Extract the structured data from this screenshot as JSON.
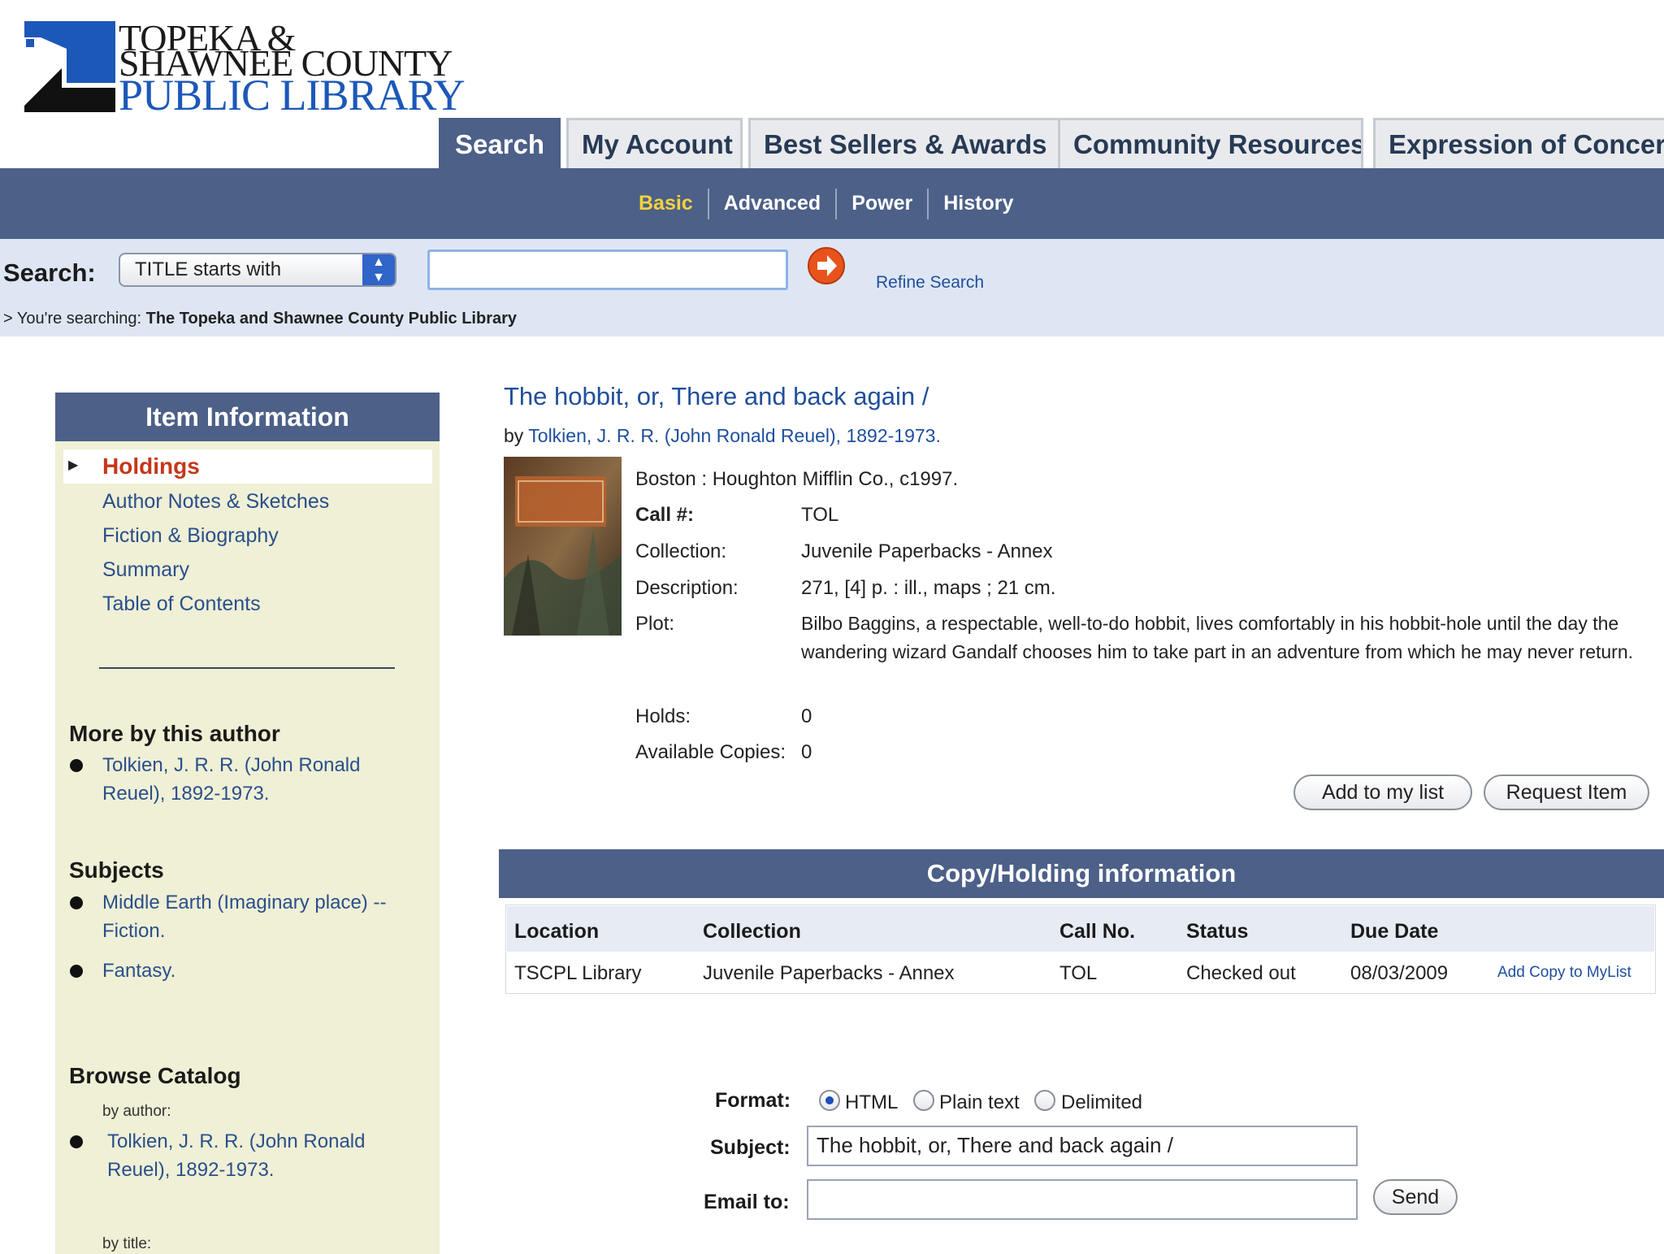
{
  "logo": {
    "line1": "TOPEKA &",
    "line2": "SHAWNEE COUNTY",
    "line3": "PUBLIC LIBRARY"
  },
  "tabs": [
    "Search",
    "My Account",
    "Best Sellers & Awards",
    "Community Resources",
    "Expression of Concern"
  ],
  "subnav": [
    "Basic",
    "Advanced",
    "Power",
    "History"
  ],
  "search": {
    "label": "Search:",
    "select_value": "TITLE starts with",
    "input_value": "",
    "refine": "Refine Search",
    "searching_prefix": "> You're searching:",
    "searching_library": "The Topeka and Shawnee County Public Library"
  },
  "sidebar": {
    "header": "Item Information",
    "holdings": "Holdings",
    "links": [
      "Author Notes & Sketches",
      "Fiction & Biography",
      "Summary",
      "Table of Contents"
    ],
    "more_heading": "More by this author",
    "more_item": "Tolkien, J. R. R. (John Ronald Reuel), 1892-1973.",
    "subjects_heading": "Subjects",
    "subjects": [
      "Middle Earth (Imaginary place) -- Fiction.",
      "Fantasy."
    ],
    "browse_heading": "Browse Catalog",
    "browse_by_author": "by author:",
    "browse_author_item": "Tolkien, J. R. R. (John Ronald Reuel), 1892-1973.",
    "browse_by_title": "by title:"
  },
  "item": {
    "title": "The hobbit, or, There and back again /",
    "by_prefix": "by",
    "author": "Tolkien, J. R. R. (John Ronald Reuel), 1892-1973.",
    "publisher": "Boston : Houghton Mifflin Co., c1997.",
    "call_label": "Call #:",
    "call_value": "TOL",
    "collection_label": "Collection:",
    "collection_value": "Juvenile Paperbacks - Annex",
    "description_label": "Description:",
    "description_value": "271, [4] p. : ill., maps ; 21 cm.",
    "plot_label": "Plot:",
    "plot_value": "Bilbo Baggins, a respectable, well-to-do hobbit, lives comfortably in his hobbit-hole until the day the wandering wizard Gandalf chooses him to take part in an adventure from which he may never return.",
    "holds_label": "Holds:",
    "holds_value": "0",
    "copies_label": "Available Copies:",
    "copies_value": "0",
    "add_list": "Add to my list",
    "request": "Request Item"
  },
  "copy": {
    "header": "Copy/Holding information",
    "columns": [
      "Location",
      "Collection",
      "Call No.",
      "Status",
      "Due Date"
    ],
    "row": [
      "TSCPL Library",
      "Juvenile Paperbacks - Annex",
      "TOL",
      "Checked out",
      "08/03/2009"
    ],
    "add_copy": "Add Copy to MyList"
  },
  "email": {
    "format_label": "Format:",
    "formats": [
      "HTML",
      "Plain text",
      "Delimited"
    ],
    "selected_format": "HTML",
    "subject_label": "Subject:",
    "subject_value": "The hobbit, or, There and back again /",
    "email_label": "Email to:",
    "email_value": "",
    "send": "Send"
  },
  "colors": {
    "navy": "#4c6088",
    "link": "#1f4f9c",
    "holdings": "#c5371a",
    "basic": "#f5d33d",
    "sidebar_bg": "#eff0d5"
  },
  "icons": {
    "go": "arrow-right-circle-icon",
    "select": "updown-arrows-icon",
    "cover": "book-cover-image"
  }
}
